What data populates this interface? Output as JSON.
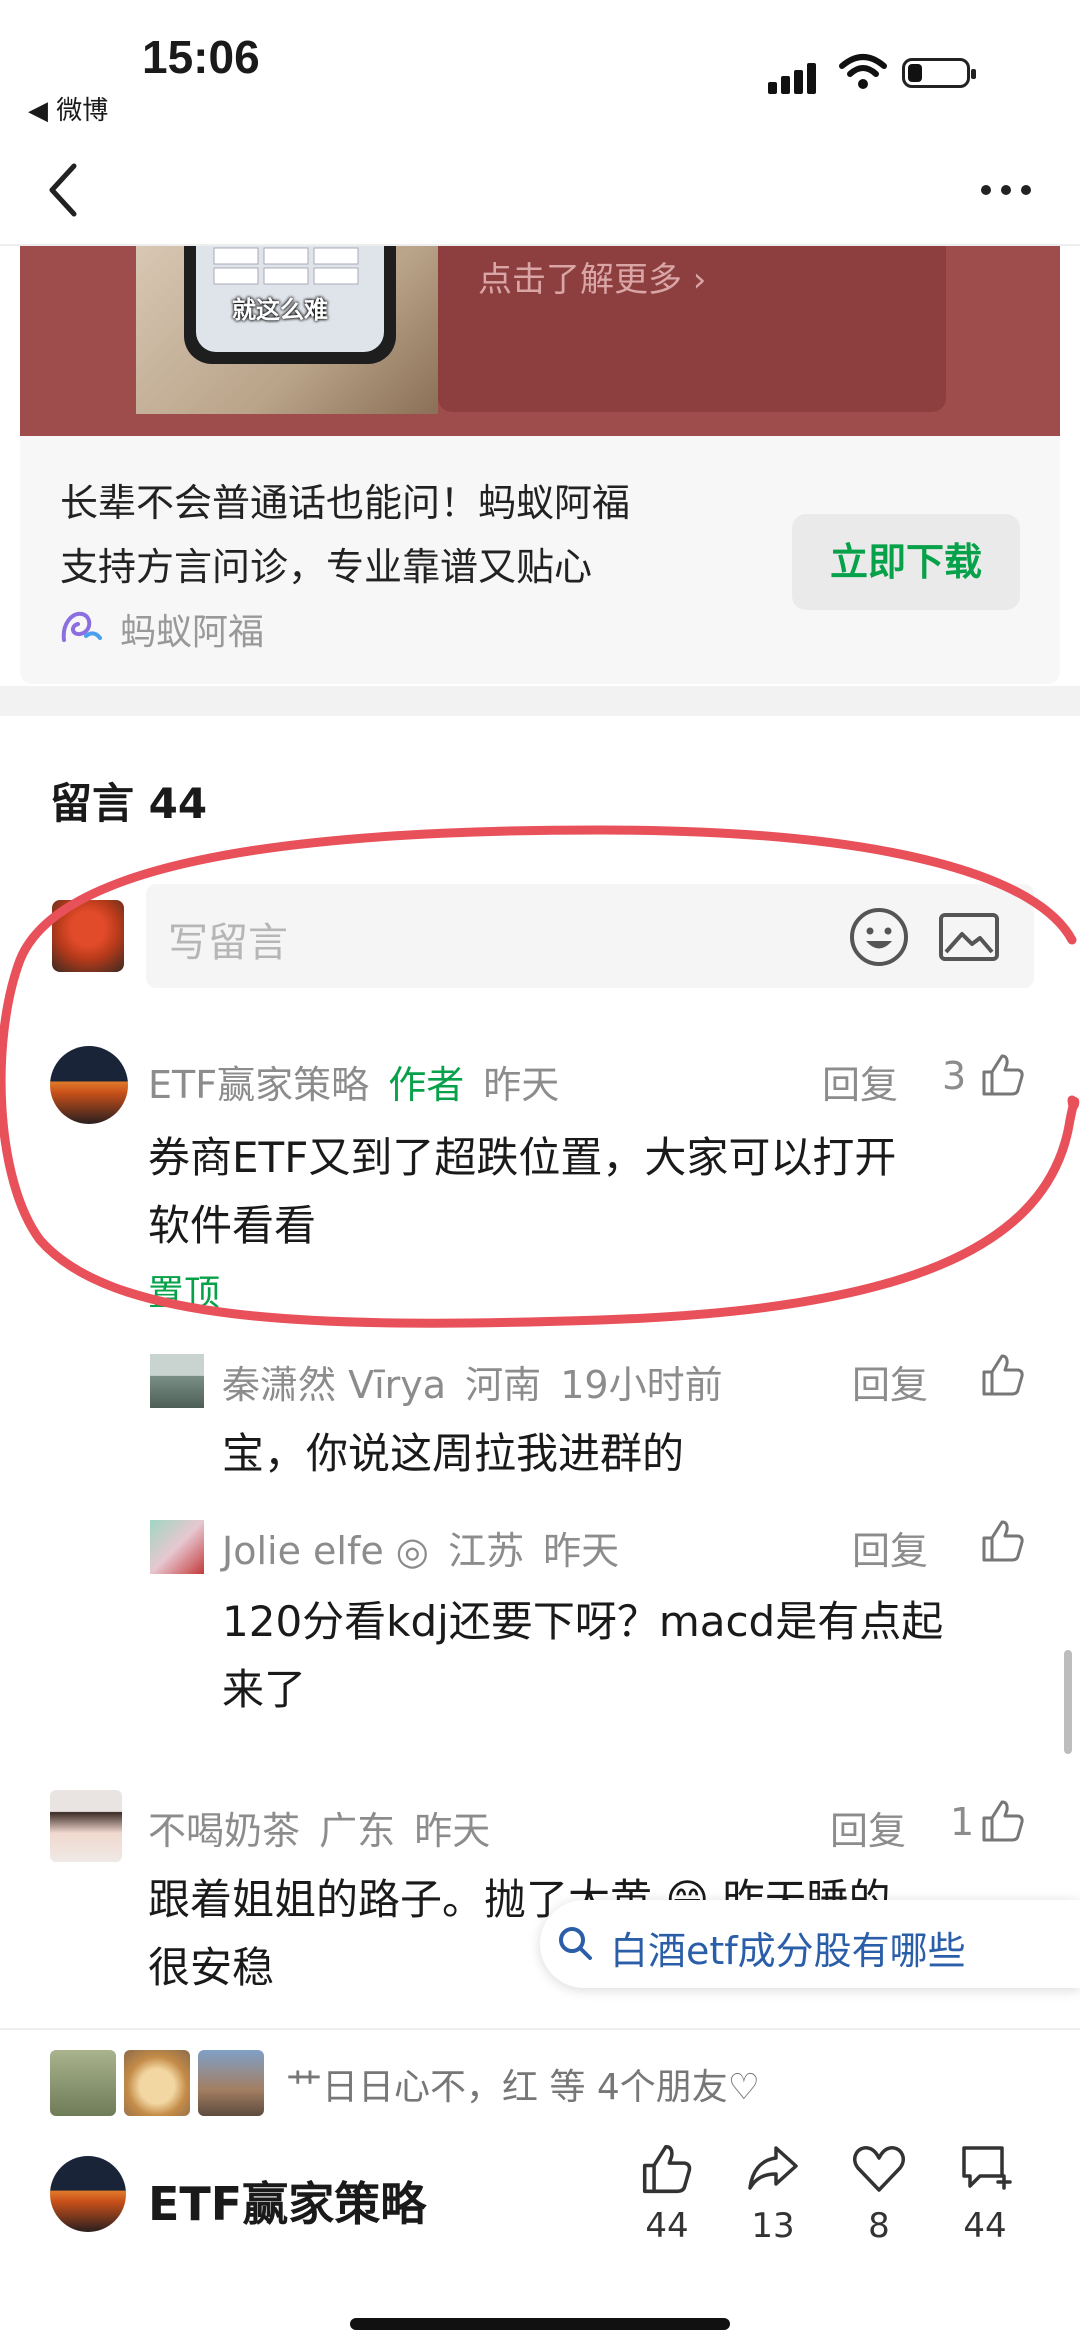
{
  "status_bar": {
    "time": "15:06",
    "back_app": "◀ 微博"
  },
  "ad": {
    "learn_more": "点击了解更多 ›",
    "phone_caption": "就这么难",
    "title_line1": "长辈不会普通话也能问！蚂蚁阿福",
    "title_line2": "支持方言问诊，专业靠谱又贴心",
    "brand": "蚂蚁阿福",
    "download_label": "立即下载"
  },
  "comments": {
    "title": "留言 44",
    "input_placeholder": "写留言",
    "items": [
      {
        "author": "ETF赢家策略",
        "author_tag": "作者",
        "time": "昨天",
        "reply": "回复",
        "likes": "3",
        "text_line1": "券商ETF又到了超跌位置，大家可以打开",
        "text_line2": "软件看看",
        "pinned": "置顶"
      },
      {
        "author": "不喝奶茶",
        "location": "广东",
        "time": "昨天",
        "reply": "回复",
        "likes": "1",
        "text_line1": "跟着姐姐的路子。抛了大黄 😁 昨天睡的",
        "text_line2": "很安稳"
      }
    ],
    "replies": [
      {
        "author": "秦潇然 Vīrya",
        "location": "河南",
        "time": "19小时前",
        "reply": "回复",
        "text_line1": "宝，你说这周拉我进群的"
      },
      {
        "author": "Jolie elfe ◎",
        "location": "江苏",
        "time": "昨天",
        "reply": "回复",
        "text_line1": "120分看kdj还要下呀？macd是有点起",
        "text_line2": "来了"
      }
    ]
  },
  "search_suggestion": "白酒etf成分股有哪些",
  "footer": {
    "friends_text": "艹日日心不，红 等 4个朋友♡",
    "account_name": "ETF赢家策略",
    "actions": [
      {
        "icon": "thumbs-up-icon",
        "count": "44"
      },
      {
        "icon": "share-icon",
        "count": "13"
      },
      {
        "icon": "heart-icon",
        "count": "8"
      },
      {
        "icon": "comment-add-icon",
        "count": "44"
      }
    ]
  },
  "colors": {
    "accent_green": "#07a14a",
    "ad_banner": "#9e4d4c",
    "annotation_red": "#e8505a"
  }
}
